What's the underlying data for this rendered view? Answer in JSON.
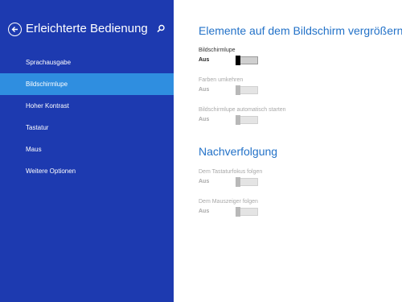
{
  "sidebar": {
    "title": "Erleichterte Bedienung",
    "back_icon": "back-arrow-icon",
    "search_icon": "search-icon",
    "items": [
      {
        "label": "Sprachausgabe"
      },
      {
        "label": "Bildschirmlupe"
      },
      {
        "label": "Hoher Kontrast"
      },
      {
        "label": "Tastatur"
      },
      {
        "label": "Maus"
      },
      {
        "label": "Weitere Optionen"
      }
    ],
    "active_index": 1,
    "colors": {
      "background": "#1d3ab0",
      "active": "#2f8ee0"
    }
  },
  "main": {
    "section1": {
      "title": "Elemente auf dem Bildschirm vergrößern",
      "settings": [
        {
          "label": "Bildschirmlupe",
          "state": "Aus",
          "enabled": true
        },
        {
          "label": "Farben umkehren",
          "state": "Aus",
          "enabled": false
        },
        {
          "label": "Bildschirmlupe automatisch starten",
          "state": "Aus",
          "enabled": false
        }
      ]
    },
    "section2": {
      "title": "Nachverfolgung",
      "settings": [
        {
          "label": "Dem Tastaturfokus folgen",
          "state": "Aus",
          "enabled": false
        },
        {
          "label": "Dem Mauszeiger folgen",
          "state": "Aus",
          "enabled": false
        }
      ]
    },
    "colors": {
      "heading": "#2372c8"
    }
  }
}
